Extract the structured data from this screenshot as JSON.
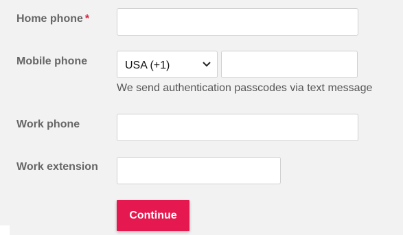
{
  "form": {
    "home_phone": {
      "label": "Home phone",
      "required_marker": "*",
      "value": ""
    },
    "mobile_phone": {
      "label": "Mobile phone",
      "country_selected": "USA (+1)",
      "value": "",
      "helper_text": "We send authentication passcodes via text message"
    },
    "work_phone": {
      "label": "Work phone",
      "value": ""
    },
    "work_extension": {
      "label": "Work extension",
      "value": ""
    },
    "continue_label": "Continue"
  },
  "colors": {
    "background": "#f2f2f2",
    "label": "#666666",
    "required": "#d62140",
    "button": "#e5194f",
    "button_text": "#ffffff"
  },
  "icons": {
    "dropdown": "chevron-down-icon"
  }
}
